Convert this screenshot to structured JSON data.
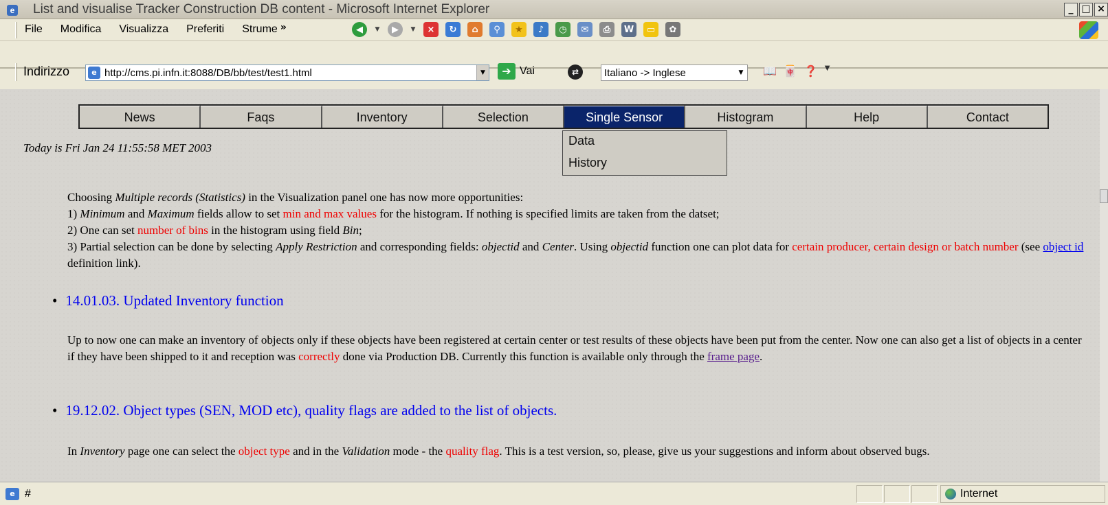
{
  "window": {
    "title": "List and visualise Tracker Construction DB content - Microsoft Internet Explorer",
    "controls": [
      "_",
      "□",
      "×"
    ]
  },
  "menubar": {
    "items": [
      "File",
      "Modifica",
      "Visualizza",
      "Preferiti",
      "Strume"
    ],
    "more": "»"
  },
  "toolbar": {
    "icons": [
      "back-icon",
      "forward-icon",
      "stop-icon",
      "refresh-icon",
      "home-icon",
      "search-icon",
      "favorites-icon",
      "media-icon",
      "history-icon",
      "mail-icon",
      "print-icon",
      "edit-icon",
      "discuss-icon",
      "messenger-icon"
    ]
  },
  "address": {
    "label": "Indirizzo",
    "url": "http://cms.pi.infn.it:8088/DB/bb/test/test1.html",
    "go_label": "Vai"
  },
  "translate": {
    "value": "Italiano -> Inglese"
  },
  "nav": {
    "items": [
      "News",
      "Faqs",
      "Inventory",
      "Selection",
      "Single Sensor",
      "Histogram",
      "Help",
      "Contact"
    ],
    "active": "Single Sensor"
  },
  "dropdown": {
    "items": [
      "Data",
      "History"
    ]
  },
  "page": {
    "date": "Today is Fri Jan 24 11:55:58 MET 2003",
    "intro": {
      "p1_a": "Choosing ",
      "p1_em": "Multiple records (Statistics)",
      "p1_b": " in the Visualization panel one has now more opportunities:",
      "p2_a": "1) ",
      "p2_em1": "Minimum",
      "p2_b": " and ",
      "p2_em2": "Maximum",
      "p2_c": " fields allow to set ",
      "p2_red": "min and max values",
      "p2_d": " for the histogram. If nothing is specified limits are taken from the datset;",
      "p3_a": "2) One can set ",
      "p3_red": "number of bins",
      "p3_b": " in the histogram using field ",
      "p3_em": "Bin",
      "p3_c": ";",
      "p4_a": "3) Partial selection can be done by selecting ",
      "p4_em1": "Apply Restriction",
      "p4_b": " and corresponding fields: ",
      "p4_em2": "objectid",
      "p4_c": " and ",
      "p4_em3": "Center",
      "p4_d": ". Using ",
      "p4_em4": "objectid",
      "p4_e": " function one can plot data for ",
      "p4_red": "certain producer, certain design or batch number",
      "p4_f": " (see ",
      "p4_link": "object id ",
      "p4_g": "definition link)."
    },
    "news1": {
      "heading": "14.01.03. Updated Inventory function",
      "text_a": "Up to now one can make an inventory of objects only if these objects have been registered at certain center or test results of these objects have been put from the center. Now one can also get a list of objects in a center if they have been shipped to it and reception was ",
      "text_red": "correctly",
      "text_b": " done via Production DB. Currently this function is available only through the ",
      "text_link": "frame page",
      "text_c": "."
    },
    "news2": {
      "heading": "19.12.02. Object types (SEN, MOD etc), quality flags are added to the list of objects.",
      "text_a": "In ",
      "text_em1": "Inventory",
      "text_b": " page one can select the ",
      "text_red1": "object type",
      "text_c": " and in the ",
      "text_em2": "Validation",
      "text_d": " mode - the ",
      "text_red2": "quality flag",
      "text_e": ". This is a test version, so, please, give us your suggestions and inform about observed bugs."
    }
  },
  "status": {
    "text": "#",
    "zone": "Internet"
  }
}
